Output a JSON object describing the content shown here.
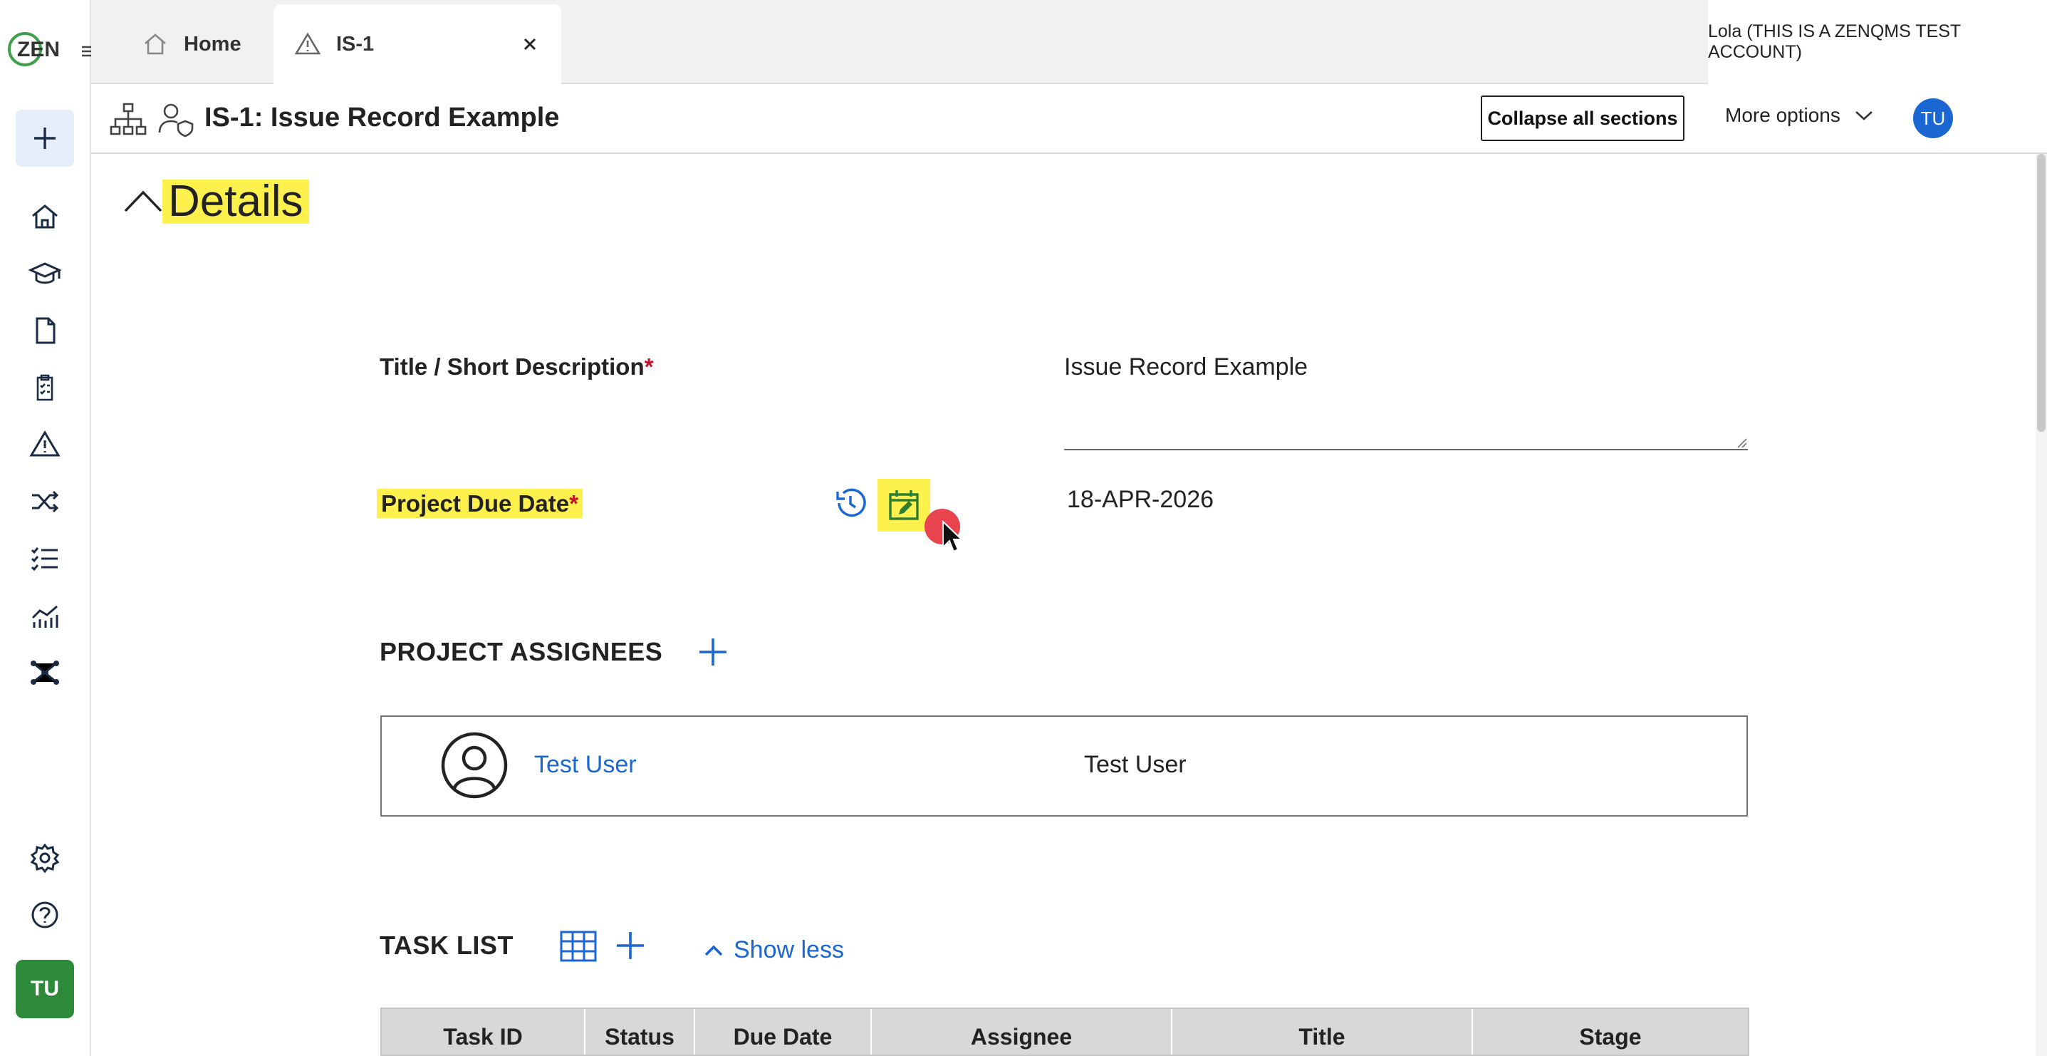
{
  "app": {
    "logo_text": "ZEN"
  },
  "tabs": [
    {
      "label": "Home",
      "icon": "home-icon"
    },
    {
      "label": "IS-1",
      "icon": "warning-icon"
    }
  ],
  "user_account": "Lola (THIS IS A ZENQMS TEST ACCOUNT)",
  "record": {
    "title": "IS-1: Issue Record Example",
    "collapse_label": "Collapse all sections",
    "more_options_label": "More options",
    "avatar_initials": "TU"
  },
  "sidebar": {
    "icons": [
      "add-icon",
      "home-icon",
      "training-icon",
      "document-icon",
      "clipboard-icon",
      "warning-icon",
      "shuffle-icon",
      "checklist-icon",
      "analytics-icon",
      "network-icon",
      "settings-icon",
      "help-icon"
    ],
    "avatar_initials": "TU"
  },
  "details": {
    "section_title": "Details",
    "title_label": "Title / Short Description",
    "title_value": "Issue Record Example",
    "due_date_label": "Project Due Date",
    "due_date_value": "18-APR-2026",
    "required_mark": "*"
  },
  "assignees": {
    "heading": "PROJECT ASSIGNEES",
    "items": [
      {
        "link": "Test User",
        "name": "Test User"
      }
    ]
  },
  "task_list": {
    "heading": "TASK LIST",
    "show_less_label": "Show less",
    "columns": [
      "Task ID",
      "Status",
      "Due Date",
      "Assignee",
      "Title",
      "Stage"
    ]
  },
  "colors": {
    "accent": "#1a66d2",
    "highlight": "#fff14d",
    "brand_green": "#2d8a3a",
    "required": "#c8102e"
  }
}
